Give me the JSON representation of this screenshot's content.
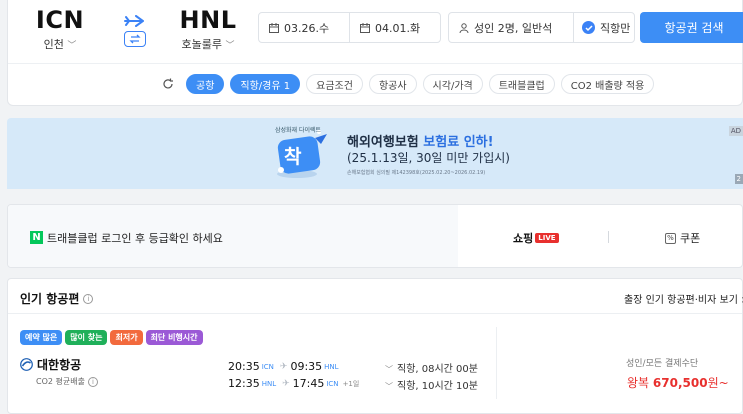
{
  "search": {
    "origin": {
      "code": "ICN",
      "city": "인천"
    },
    "destination": {
      "code": "HNL",
      "city": "호놀룰루"
    },
    "departure_date": "03.26.수",
    "return_date": "04.01.화",
    "passengers": "성인 2명, 일반석",
    "direct_only": "직항만",
    "search_button": "항공권 검색"
  },
  "filters": [
    {
      "label": "공항",
      "active": true
    },
    {
      "label": "직항/경유 1",
      "active": true
    },
    {
      "label": "요금조건",
      "active": false
    },
    {
      "label": "항공사",
      "active": false
    },
    {
      "label": "시각/가격",
      "active": false
    },
    {
      "label": "트래블클럽",
      "active": false
    },
    {
      "label": "CO2 배출량 적용",
      "active": false
    }
  ],
  "banner": {
    "brand": "삼성화재 다이렉트",
    "badge": "착",
    "title_prefix": "해외여행보험 ",
    "title_highlight": "보험료 인하!",
    "subtitle": "(25.1.13일, 30일 미만 가입시)",
    "fine_print": "손해보험협회 심의필 제142398호(2025.02.20~2026.02.19)",
    "ad_tag": "AD",
    "page_tag": "2"
  },
  "naver": {
    "logo": "N",
    "login_text": "트래블클럽 로그인 후 등급확인 하세요",
    "shopping": "쇼핑",
    "live": "LIVE",
    "coupon": "쿠폰",
    "coupon_icon": "%"
  },
  "popular": {
    "title": "인기 항공편",
    "link": "출장 인기 항공편·비자 보기 >",
    "tags": [
      {
        "label": "예약 많은",
        "color": "#3d8ef5"
      },
      {
        "label": "많이 찾는",
        "color": "#1fb05a"
      },
      {
        "label": "최저가",
        "color": "#f26a3d"
      },
      {
        "label": "최단 비행시간",
        "color": "#9b59d6"
      }
    ],
    "airline": "대한항공",
    "co2": "CO2 평균배출",
    "legs": [
      {
        "dep_time": "20:35",
        "dep_ap": "ICN",
        "arr_time": "09:35",
        "arr_ap": "HNL",
        "plus": "",
        "duration": "직항, 08시간 00분"
      },
      {
        "dep_time": "12:35",
        "dep_ap": "HNL",
        "arr_time": "17:45",
        "arr_ap": "ICN",
        "plus": "+1일",
        "duration": "직항, 10시간 10분"
      }
    ],
    "price_label": "성인/모든 결제수단",
    "price_prefix": "왕복 ",
    "price_value": "670,500",
    "price_suffix": "원~"
  },
  "colors": {
    "accent": "#3d8ef5",
    "price": "#e8302e",
    "naver_green": "#03c75a",
    "banner_bg": "#d6e9f9"
  },
  "icons": [
    "plane-icon",
    "swap-icon",
    "calendar-icon",
    "person-icon",
    "check-icon",
    "refresh-icon",
    "naver-logo",
    "coupon-icon",
    "info-icon",
    "korean-air-logo",
    "chevron-down-icon"
  ]
}
